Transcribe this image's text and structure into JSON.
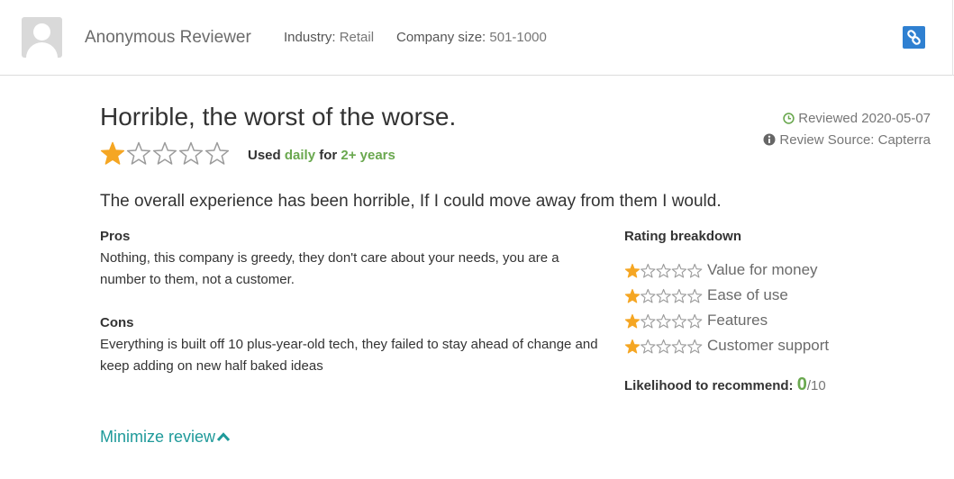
{
  "reviewer": {
    "name": "Anonymous Reviewer",
    "industry_label": "Industry:",
    "industry_value": "Retail",
    "company_size_label": "Company size:",
    "company_size_value": "501-1000"
  },
  "review": {
    "title": "Horrible, the worst of the worse.",
    "overall_rating": 1,
    "overall_max": 5,
    "usage_prefix": "Used",
    "usage_frequency": "daily",
    "usage_for": "for",
    "usage_duration": "2+ years",
    "reviewed_label": "Reviewed 2020-05-07",
    "source_label": "Review Source: Capterra",
    "summary": "The overall experience has been horrible, If I could move away from them I would.",
    "pros_heading": "Pros",
    "pros_text": "Nothing, this company is greedy, they don't care about your needs, you are a number to them, not a customer.",
    "cons_heading": "Cons",
    "cons_text": "Everything is built off 10 plus-year-old tech, they failed to stay ahead of change and keep adding on new half baked ideas"
  },
  "breakdown": {
    "title": "Rating breakdown",
    "items": [
      {
        "label": "Value for money",
        "rating": 1
      },
      {
        "label": "Ease of use",
        "rating": 1
      },
      {
        "label": "Features",
        "rating": 1
      },
      {
        "label": "Customer support",
        "rating": 1
      }
    ],
    "max": 5,
    "likelihood_label": "Likelihood to recommend:",
    "likelihood_score": "0",
    "likelihood_outof": "/10"
  },
  "actions": {
    "minimize_label": "Minimize review"
  },
  "icons": {
    "avatar": "user-placeholder-icon",
    "link": "link-icon",
    "clock": "clock-icon",
    "info": "info-icon",
    "chevron": "chevron-up-icon",
    "star": "star-icon"
  },
  "colors": {
    "star_filled": "#f5a623",
    "star_empty": "#9b9b9b",
    "accent_green": "#6aa84f",
    "link_teal": "#1f9a9a",
    "link_button": "#2f80d1"
  }
}
